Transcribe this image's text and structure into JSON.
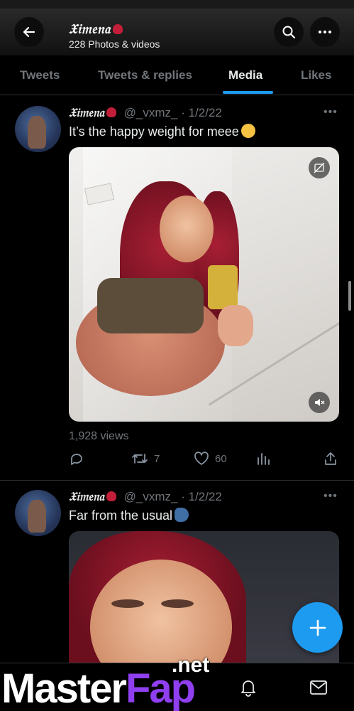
{
  "header": {
    "name": "𝔛𝔦𝔪𝔢𝔫𝔞",
    "subtitle": "228 Photos & videos"
  },
  "tabs": [
    {
      "label": "Tweets"
    },
    {
      "label": "Tweets & replies"
    },
    {
      "label": "Media",
      "active": true
    },
    {
      "label": "Likes"
    }
  ],
  "tweets": [
    {
      "name": "𝔛𝔦𝔪𝔢𝔫𝔞",
      "handle": "@_vxmz_",
      "date": "· 1/2/22",
      "text": "It’s the happy weight for meee",
      "views": "1,928 views",
      "retweets": "7",
      "likes": "60"
    },
    {
      "name": "𝔛𝔦𝔪𝔢𝔫𝔞",
      "handle": "@_vxmz_",
      "date": "· 1/2/22",
      "text": "Far from the usual"
    }
  ],
  "watermark": {
    "main_a": "Master",
    "main_b": "Fap",
    "net": ".net"
  },
  "colors": {
    "accent": "#1d9bf0",
    "background": "#000000",
    "muted": "#71767b"
  },
  "icons": [
    "back-arrow-icon",
    "search-icon",
    "more-icon",
    "reply-icon",
    "retweet-icon",
    "like-icon",
    "analytics-icon",
    "share-icon",
    "plus-icon",
    "bell-icon",
    "mail-icon",
    "mute-icon",
    "sensitive-media-icon"
  ]
}
